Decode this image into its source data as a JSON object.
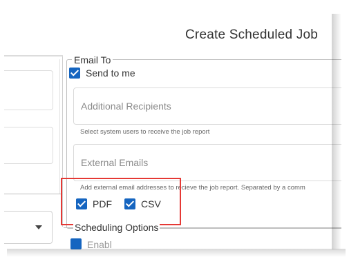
{
  "dialog": {
    "title": "Create Scheduled Job"
  },
  "email_to": {
    "legend": "Email To",
    "send_to_me": {
      "label": "Send to me",
      "checked": true
    },
    "additional_recipients": {
      "placeholder": "Additional Recipients",
      "helper": "Select system users to receive the job report"
    },
    "external_emails": {
      "placeholder": "External Emails",
      "helper": "Add external email addresses to recieve the job report. Separated by a comm"
    },
    "formats": [
      {
        "label": "PDF",
        "checked": true
      },
      {
        "label": "CSV",
        "checked": true
      }
    ]
  },
  "scheduling": {
    "legend": "Scheduling Options",
    "partial_option": "Enabl"
  },
  "colors": {
    "accent": "#1565c0",
    "highlight": "#e53935"
  }
}
